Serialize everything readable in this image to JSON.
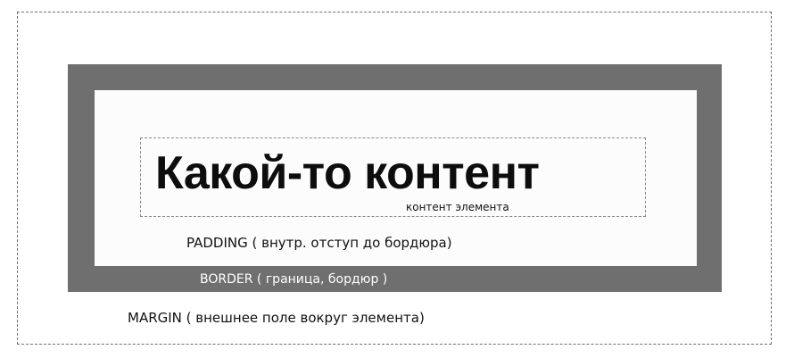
{
  "diagram": {
    "content_main": "Какой-то контент",
    "content_caption": "контент элемента",
    "padding_label": "PADDING ( внутр. отступ до бордюра)",
    "border_label": "BORDER  ( граница, бордюр )",
    "margin_label": "MARGIN  ( внешнее поле вокруг элемента)"
  },
  "colors": {
    "border_fill": "#6f6f6f",
    "padding_fill": "#fcfcfc",
    "dashed_line": "#6f6f6f",
    "text_dark": "#111111",
    "text_light": "#ffffff"
  }
}
